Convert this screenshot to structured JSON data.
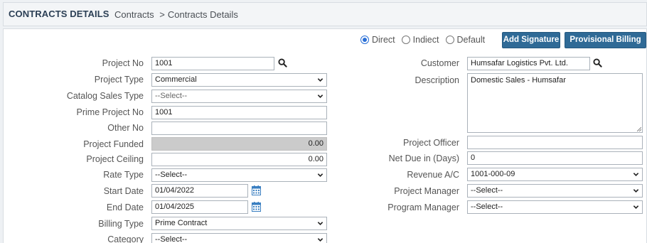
{
  "header": {
    "title": "CONTRACTS DETAILS",
    "breadcrumb": {
      "parent": "Contracts",
      "separator": ">",
      "current": "Contracts Details"
    }
  },
  "options": {
    "radios": [
      {
        "label": "Direct",
        "checked": true
      },
      {
        "label": "Indiect",
        "checked": false
      },
      {
        "label": "Default",
        "checked": false
      }
    ],
    "add_signature": "Add Signature",
    "provisional_billing_rate": "Provisional Billing Rate"
  },
  "left": {
    "project_no": {
      "label": "Project No",
      "value": "1001"
    },
    "project_type": {
      "label": "Project Type",
      "value": "Commercial"
    },
    "catalog_sales_type": {
      "label": "Catalog Sales Type",
      "value": "--Select--"
    },
    "prime_project_no": {
      "label": "Prime Project No",
      "value": "1001"
    },
    "other_no": {
      "label": "Other No",
      "value": ""
    },
    "project_funded": {
      "label": "Project Funded",
      "value": "0.00"
    },
    "project_ceiling": {
      "label": "Project Ceiling",
      "value": "0.00"
    },
    "rate_type": {
      "label": "Rate Type",
      "value": "--Select--"
    },
    "start_date": {
      "label": "Start Date",
      "value": "01/04/2022"
    },
    "end_date": {
      "label": "End Date",
      "value": "01/04/2025"
    },
    "billing_type": {
      "label": "Billing Type",
      "value": "Prime Contract"
    },
    "category": {
      "label": "Category",
      "value": "--Select--"
    }
  },
  "right": {
    "customer": {
      "label": "Customer",
      "value": "Humsafar Logistics Pvt. Ltd."
    },
    "description": {
      "label": "Description",
      "value": "Domestic Sales - Humsafar"
    },
    "project_officer": {
      "label": "Project Officer",
      "value": ""
    },
    "net_due": {
      "label": "Net Due in (Days)",
      "value": "0"
    },
    "revenue_ac": {
      "label": "Revenue A/C",
      "value": "1001-000-09"
    },
    "project_manager": {
      "label": "Project Manager",
      "value": "--Select--"
    },
    "program_manager": {
      "label": "Program Manager",
      "value": "--Select--"
    }
  },
  "icons": {
    "search": "search-icon",
    "calendar": "calendar-icon",
    "dropdown": "chevron-down-icon"
  },
  "colors": {
    "primary_button": "#2f6a96",
    "radio_accent": "#2a6fd6",
    "calendar": "#3a7fc1",
    "disabled_field": "#cbcbcb"
  }
}
